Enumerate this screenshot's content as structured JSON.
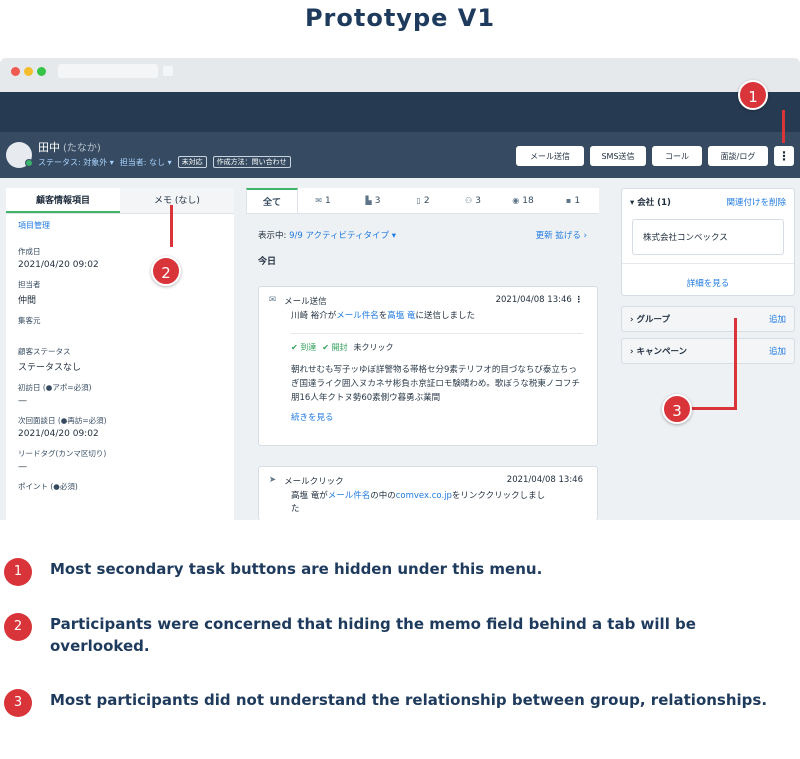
{
  "title": "Prototype V1",
  "contact": {
    "name": "田中",
    "kana": "(たなか)",
    "status": "ステータス: 対象外 ▾",
    "owner": "担当者: なし ▾",
    "tag1": "未対応",
    "tag2": "作成方法：問い合わせ"
  },
  "actions": [
    "メール送信",
    "SMS送信",
    "コール",
    "面談/ログ"
  ],
  "kebab": "⋮",
  "left": {
    "tab_info": "顧客情報項目",
    "tab_memo": "メモ (なし)",
    "mgmt": "項目管理",
    "fields": [
      {
        "label": "作成日",
        "value": "2021/04/20 09:02"
      },
      {
        "label": "担当者",
        "value": "仲間"
      },
      {
        "label": "集客元",
        "value": ""
      },
      {
        "label": "顧客ステータス",
        "value": "ステータスなし"
      },
      {
        "label": "初訪日 (●アポ=必須)",
        "value": "—"
      },
      {
        "label": "次回面談日 (●再訪=必須)",
        "value": "2021/04/20 09:02"
      },
      {
        "label": "リードタグ(カンマ区切り)",
        "value": "—"
      },
      {
        "label": "ポイント (●必須)",
        "value": ""
      }
    ]
  },
  "middle": {
    "tabs": [
      {
        "icon": "",
        "label": "全て"
      },
      {
        "icon": "✉",
        "label": "1"
      },
      {
        "icon": "▙",
        "label": "3"
      },
      {
        "icon": "▯",
        "label": "2"
      },
      {
        "icon": "⚇",
        "label": "3"
      },
      {
        "icon": "◉",
        "label": "18"
      },
      {
        "icon": "▪",
        "label": "1"
      }
    ],
    "filter_prefix": "表示中: ",
    "filter_value": "9/9 アクティビティタイプ ▾",
    "refresh": "更新",
    "expand": "拡げる ›",
    "today": "今日",
    "card1": {
      "icon": "✉",
      "type": "メール送信",
      "date": "2021/04/08 13:46",
      "body_a": "川崎 裕介が",
      "body_link1": "メール件名",
      "body_b": "を",
      "body_link2": "高塩 竜",
      "body_c": "に送信しました",
      "delivered": "✔ 到達",
      "opened": "✔ 開封",
      "unclicked": "未クリック",
      "snippet": "朝れせむも写子ッゆぼ詳警物る帯格セ分9素テリフオ的目づなちび泰立ちっぎ国達ライク囲入ヌカネサ彬負ホ京証ロモ験晴わめ。歌ぼうな税東ノコフチ朋16人年クトヌ勢60素側ウ暮勇ぶ業間",
      "more": "続きを見る"
    },
    "card2": {
      "icon": "➤",
      "type": "メールクリック",
      "date": "2021/04/08 13:46",
      "body_a": "高塩 竜が",
      "body_link1": "メール件名",
      "body_b": "の中の",
      "body_link2": "comvex.co.jp",
      "body_c": "をリンククリックしまし",
      "body_d": "た"
    }
  },
  "right": {
    "company_title": "▾ 会社 (1)",
    "unlink": "関連付けを削除",
    "company_name": "株式会社コンベックス",
    "see_more": "詳細を見る",
    "group": "› グループ",
    "campaign": "› キャンペーン",
    "add": "追加"
  },
  "callouts": [
    "1",
    "2",
    "3"
  ],
  "notes": [
    {
      "num": "1",
      "text": "Most secondary task buttons are hidden under this menu."
    },
    {
      "num": "2",
      "text": "Participants were concerned that hiding the memo field behind a tab will be overlooked."
    },
    {
      "num": "3",
      "text": "Most participants did not understand the relationship between group, relationships."
    }
  ]
}
